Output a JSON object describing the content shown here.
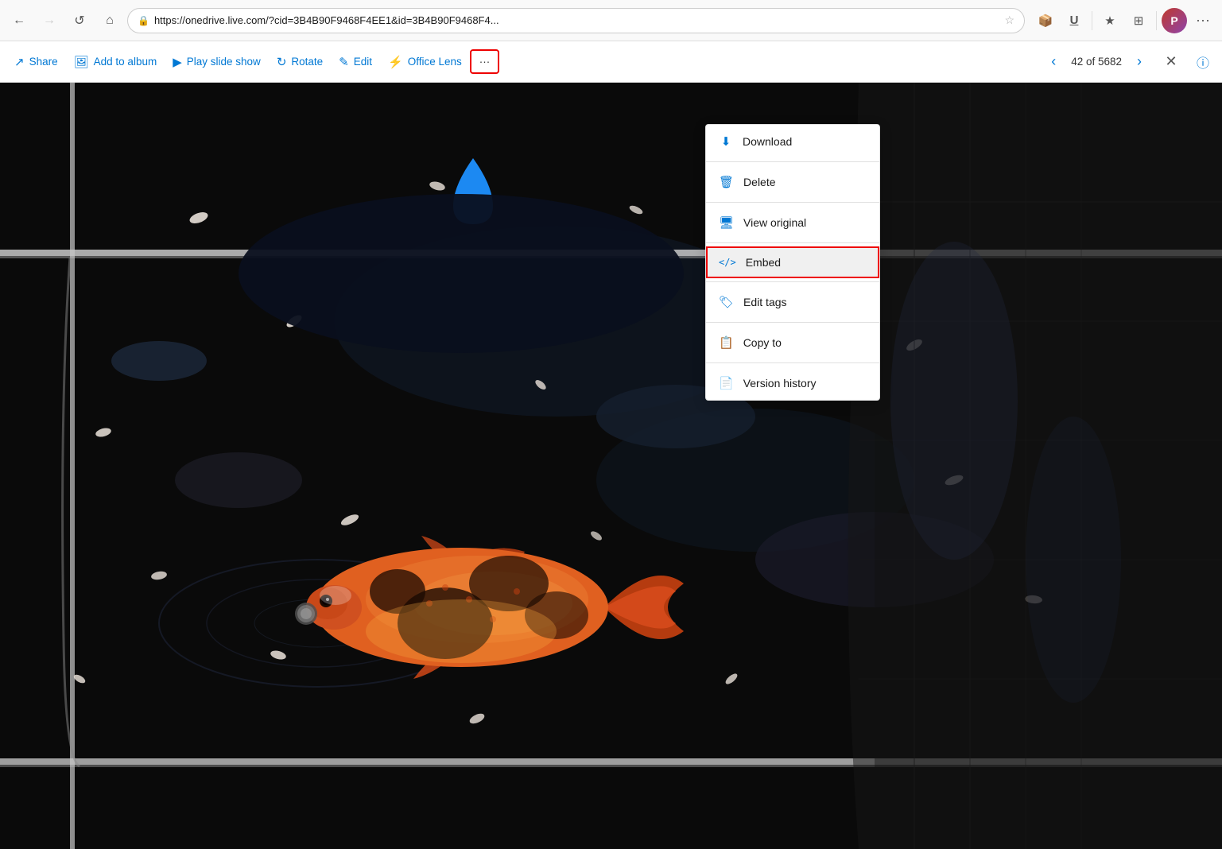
{
  "browser": {
    "back_disabled": false,
    "forward_disabled": true,
    "url": "https://onedrive.live.com/?cid=3B4B90F9468F4EE1&id=3B4B90F9468F4...",
    "nav_btns": [
      "←",
      "→",
      "↺",
      "⌂"
    ]
  },
  "toolbar": {
    "share_label": "Share",
    "add_to_album_label": "Add to album",
    "play_slide_show_label": "Play slide show",
    "rotate_label": "Rotate",
    "edit_label": "Edit",
    "office_lens_label": "Office Lens",
    "more_label": "···",
    "previous_label": "Previous",
    "counter": "42 of 5682",
    "next_label": "Next",
    "close_label": "✕",
    "info_label": "ⓘ"
  },
  "dropdown": {
    "items": [
      {
        "id": "download",
        "icon": "⬇",
        "label": "Download"
      },
      {
        "id": "delete",
        "icon": "🗑",
        "label": "Delete"
      },
      {
        "id": "view-original",
        "icon": "🖥",
        "label": "View original"
      },
      {
        "id": "embed",
        "icon": "</>",
        "label": "Embed",
        "highlighted": true
      },
      {
        "id": "edit-tags",
        "icon": "🏷",
        "label": "Edit tags"
      },
      {
        "id": "copy-to",
        "icon": "📋",
        "label": "Copy to"
      },
      {
        "id": "version-history",
        "icon": "📄",
        "label": "Version history"
      }
    ]
  }
}
